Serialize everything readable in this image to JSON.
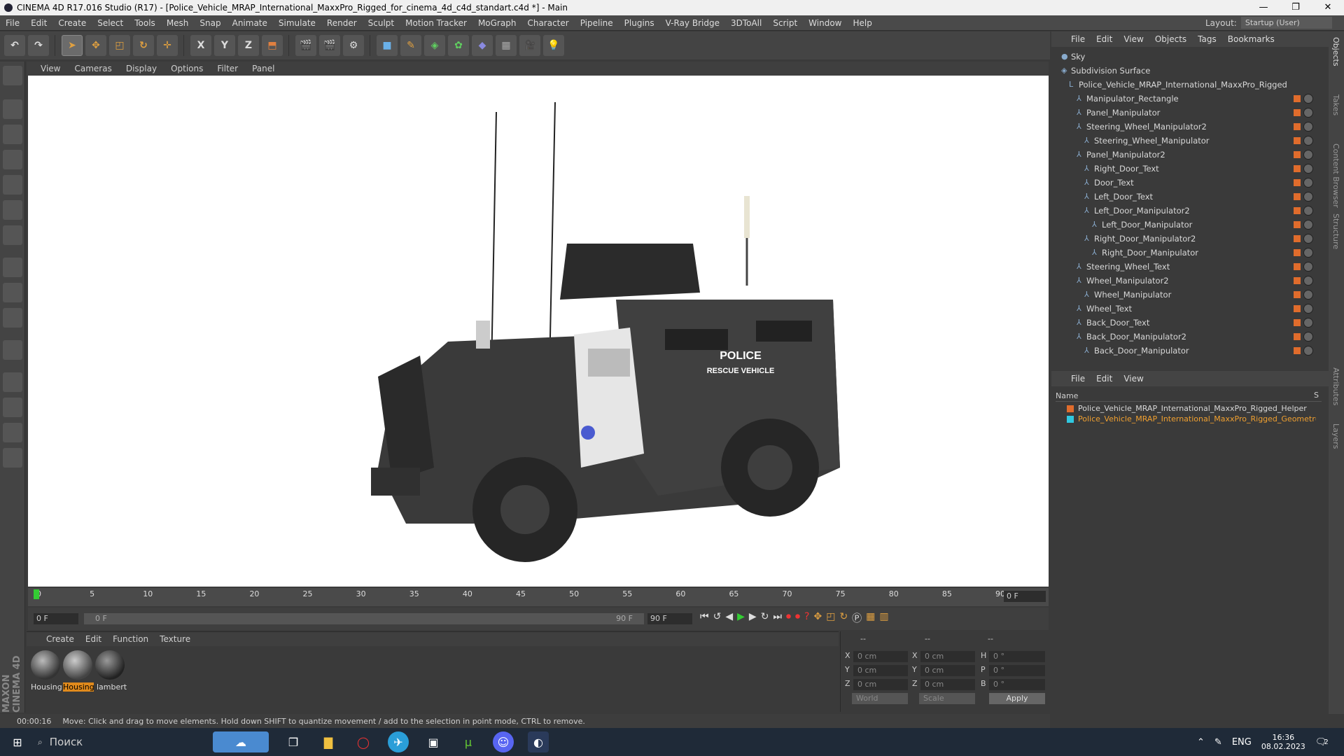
{
  "window": {
    "title": "CINEMA 4D R17.016 Studio (R17) - [Police_Vehicle_MRAP_International_MaxxPro_Rigged_for_cinema_4d_c4d_standart.c4d *] - Main",
    "minimize": "—",
    "maximize": "❐",
    "close": "✕",
    "layout_label": "Layout:",
    "layout_value": "Startup (User)"
  },
  "menu": [
    "File",
    "Edit",
    "Create",
    "Select",
    "Tools",
    "Mesh",
    "Snap",
    "Animate",
    "Simulate",
    "Render",
    "Sculpt",
    "Motion Tracker",
    "MoGraph",
    "Character",
    "Pipeline",
    "Plugins",
    "V-Ray Bridge",
    "3DToAll",
    "Script",
    "Window",
    "Help"
  ],
  "toolbar": {
    "x_label": "X",
    "y_label": "Y",
    "z_label": "Z"
  },
  "viewport": {
    "menu": [
      "View",
      "Cameras",
      "Display",
      "Options",
      "Filter",
      "Panel"
    ],
    "vehicle_text_1": "POLICE",
    "vehicle_text_2": "RESCUE VEHICLE"
  },
  "timeline": {
    "ticks": [
      "0",
      "5",
      "10",
      "15",
      "20",
      "25",
      "30",
      "35",
      "40",
      "45",
      "50",
      "55",
      "60",
      "65",
      "70",
      "75",
      "80",
      "85",
      "90"
    ],
    "current_frame": "0 F",
    "start_field": "0 F",
    "range_start": "0 F",
    "range_end": "90 F",
    "end_field": "90 F"
  },
  "materials": {
    "menu": [
      "Create",
      "Edit",
      "Function",
      "Texture"
    ],
    "items": [
      "Housing",
      "Housing",
      "lambert"
    ]
  },
  "coordinates": {
    "header": [
      "--",
      "--",
      "--"
    ],
    "rows": [
      {
        "a": "X",
        "av": "0 cm",
        "b": "X",
        "bv": "0 cm",
        "c": "H",
        "cv": "0 °"
      },
      {
        "a": "Y",
        "av": "0 cm",
        "b": "Y",
        "bv": "0 cm",
        "c": "P",
        "cv": "0 °"
      },
      {
        "a": "Z",
        "av": "0 cm",
        "b": "Z",
        "bv": "0 cm",
        "c": "B",
        "cv": "0 °"
      }
    ],
    "mode1": "World",
    "mode2": "Scale",
    "apply": "Apply"
  },
  "status": {
    "time": "00:00:16",
    "message": "Move: Click and drag to move elements. Hold down SHIFT to quantize movement / add to the selection in point mode, CTRL to remove."
  },
  "objects": {
    "menu": [
      "File",
      "Edit",
      "View",
      "Objects",
      "Tags",
      "Bookmarks"
    ],
    "items": [
      {
        "label": "Sky",
        "depth": 0
      },
      {
        "label": "Subdivision Surface",
        "depth": 0
      },
      {
        "label": "Police_Vehicle_MRAP_International_MaxxPro_Rigged",
        "depth": 1
      },
      {
        "label": "Manipulator_Rectangle",
        "depth": 2
      },
      {
        "label": "Panel_Manipulator",
        "depth": 2
      },
      {
        "label": "Steering_Wheel_Manipulator2",
        "depth": 2
      },
      {
        "label": "Steering_Wheel_Manipulator",
        "depth": 3
      },
      {
        "label": "Panel_Manipulator2",
        "depth": 2
      },
      {
        "label": "Right_Door_Text",
        "depth": 3
      },
      {
        "label": "Door_Text",
        "depth": 3
      },
      {
        "label": "Left_Door_Text",
        "depth": 3
      },
      {
        "label": "Left_Door_Manipulator2",
        "depth": 3
      },
      {
        "label": "Left_Door_Manipulator",
        "depth": 4
      },
      {
        "label": "Right_Door_Manipulator2",
        "depth": 3
      },
      {
        "label": "Right_Door_Manipulator",
        "depth": 4
      },
      {
        "label": "Steering_Wheel_Text",
        "depth": 2
      },
      {
        "label": "Wheel_Manipulator2",
        "depth": 2
      },
      {
        "label": "Wheel_Manipulator",
        "depth": 3
      },
      {
        "label": "Wheel_Text",
        "depth": 2
      },
      {
        "label": "Back_Door_Text",
        "depth": 2
      },
      {
        "label": "Back_Door_Manipulator2",
        "depth": 2
      },
      {
        "label": "Back_Door_Manipulator",
        "depth": 3
      }
    ]
  },
  "layers": {
    "menu": [
      "File",
      "Edit",
      "View"
    ],
    "column": "Name",
    "column_s": "S",
    "items": [
      {
        "label": "Police_Vehicle_MRAP_International_MaxxPro_Rigged_Helper",
        "color": "#e06c2c"
      },
      {
        "label": "Police_Vehicle_MRAP_International_MaxxPro_Rigged_Geometru",
        "color": "#30c8e0"
      }
    ]
  },
  "side_tabs": [
    "Objects",
    "Takes",
    "Content Browser",
    "Structure",
    "Attributes",
    "Layers"
  ],
  "brand": "MAXON CINEMA 4D",
  "taskbar": {
    "search": "Поиск",
    "lang": "ENG",
    "time": "16:36",
    "date": "08.02.2023",
    "notif": "2"
  }
}
